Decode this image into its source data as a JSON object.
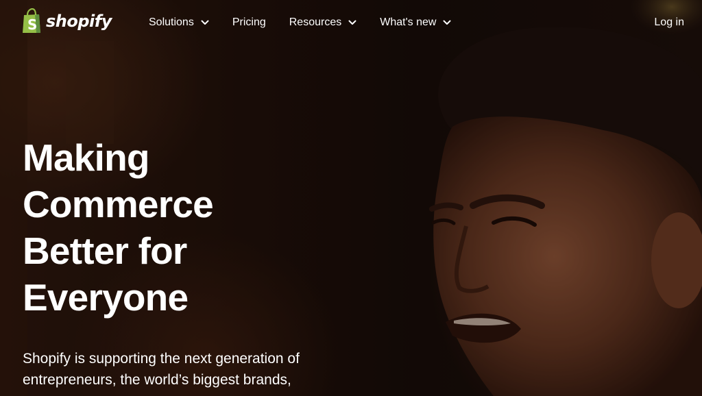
{
  "brand": {
    "name": "shopify",
    "logo_icon": "shopping-bag-icon",
    "logo_color": "#95bf47"
  },
  "nav": {
    "items": [
      {
        "label": "Solutions",
        "has_dropdown": true
      },
      {
        "label": "Pricing",
        "has_dropdown": false
      },
      {
        "label": "Resources",
        "has_dropdown": true
      },
      {
        "label": "What's new",
        "has_dropdown": true
      }
    ],
    "login_label": "Log in"
  },
  "hero": {
    "headline_lines": [
      "Making",
      "Commerce",
      "Better for",
      "Everyone"
    ],
    "subtext_lines": [
      "Shopify is supporting the next generation of",
      "entrepreneurs, the world’s biggest brands,"
    ]
  },
  "colors": {
    "text": "#ffffff",
    "background": "#120b07",
    "accent": "#95bf47"
  }
}
